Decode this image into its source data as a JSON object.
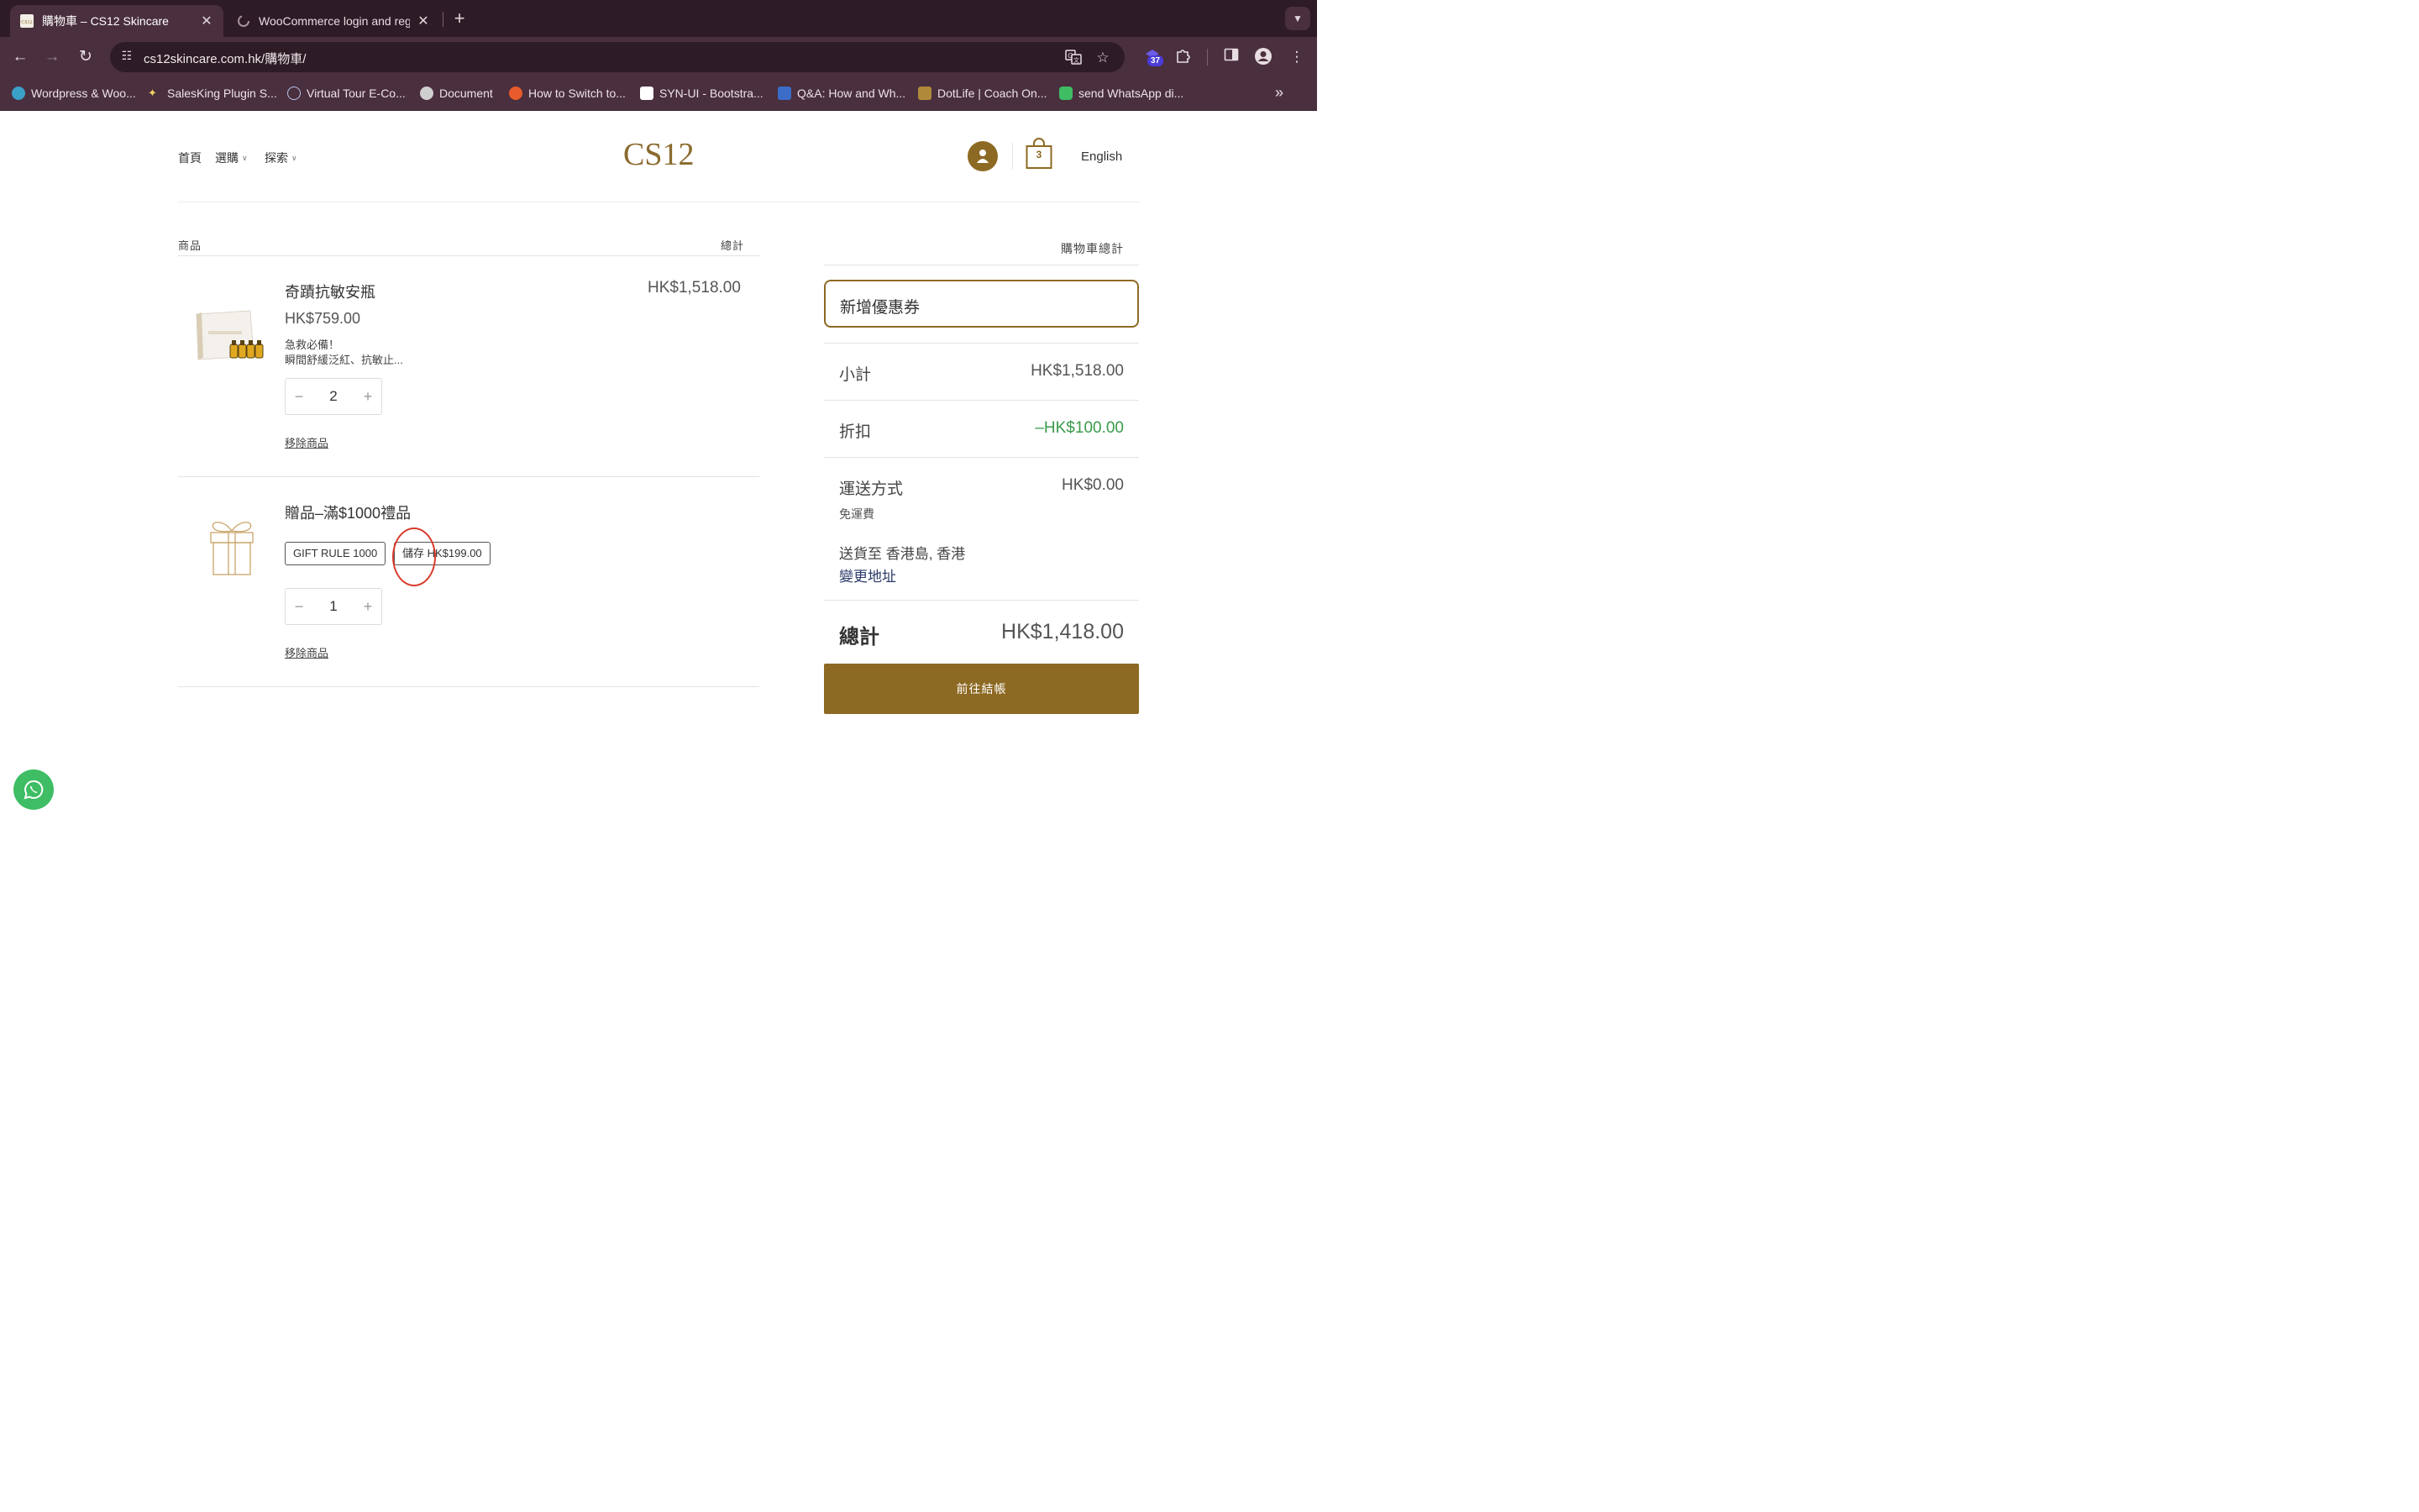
{
  "browser": {
    "tabs": [
      {
        "title": "購物車 – CS12 Skincare",
        "active": true
      },
      {
        "title": "WooCommerce login and regi",
        "active": false
      }
    ],
    "url": "cs12skincare.com.hk/購物車/",
    "extension_badge": "37",
    "bookmarks": [
      {
        "label": "Wordpress & Woo...",
        "icon": "check-circle-icon"
      },
      {
        "label": "SalesKing Plugin S...",
        "icon": "wand-icon"
      },
      {
        "label": "Virtual Tour E-Co...",
        "icon": "atom-icon"
      },
      {
        "label": "Document",
        "icon": "elephant-icon"
      },
      {
        "label": "How to Switch to...",
        "icon": "chat-bubble-icon"
      },
      {
        "label": "SYN-UI - Bootstra...",
        "icon": "bird-icon"
      },
      {
        "label": "Q&A: How and Wh...",
        "icon": "mgr-icon"
      },
      {
        "label": "DotLife | Coach On...",
        "icon": "dotlife-icon"
      },
      {
        "label": "send WhatsApp di...",
        "icon": "whatsapp-icon"
      }
    ]
  },
  "site": {
    "nav": {
      "home": "首頁",
      "shop": "選購",
      "explore": "探索"
    },
    "logo": "CS12",
    "cart_count": "3",
    "language": "English"
  },
  "cart": {
    "col_product": "商品",
    "col_total": "總計",
    "items": [
      {
        "name": "奇蹟抗敏安瓶",
        "price": "HK$759.00",
        "desc1": "急救必備！",
        "desc2": "瞬間舒緩泛紅、抗敏止...",
        "qty": "2",
        "line_total": "HK$1,518.00",
        "remove": "移除商品"
      },
      {
        "name": "贈品–滿$1000禮品",
        "tag1": "GIFT RULE 1000",
        "tag2": "儲存 HK$199.00",
        "qty": "1",
        "remove": "移除商品"
      }
    ]
  },
  "totals": {
    "heading": "購物車總計",
    "coupon": "新增優惠券",
    "subtotal_label": "小計",
    "subtotal": "HK$1,518.00",
    "discount_label": "折扣",
    "discount": "–HK$100.00",
    "shipping_label": "運送方式",
    "shipping": "HK$0.00",
    "shipping_method": "免運費",
    "ship_to": "送貨至  香港島, 香港",
    "change_address": "變更地址",
    "total_label": "總計",
    "total": "HK$1,418.00",
    "checkout": "前往結帳"
  },
  "colors": {
    "brand_gold": "#8d6a23",
    "discount_green": "#3a9a4a",
    "whatsapp_green": "#3ebd64",
    "annotation_red": "#d93a2b"
  }
}
